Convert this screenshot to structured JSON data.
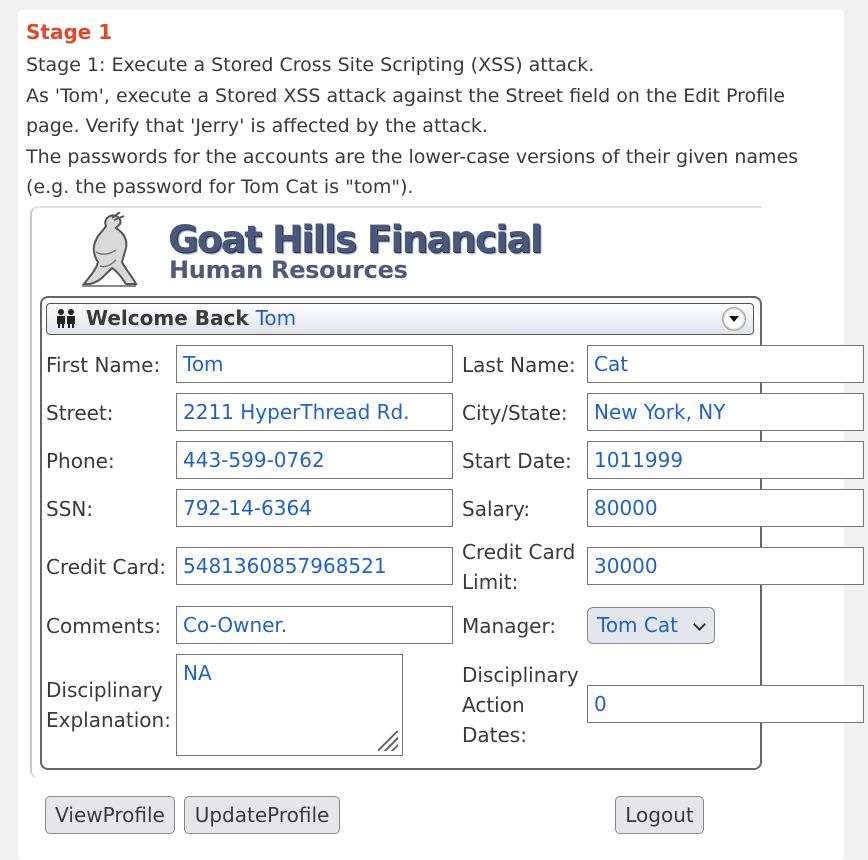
{
  "stage": {
    "title": "Stage 1",
    "lines": [
      "Stage 1: Execute a Stored Cross Site Scripting (XSS) attack.",
      "As 'Tom', execute a Stored XSS attack against the Street field on the Edit Profile",
      "page. Verify that 'Jerry' is affected by the attack.",
      "The passwords for the accounts are the lower-case versions of their given names",
      "(e.g. the password for Tom Cat is \"tom\")."
    ]
  },
  "app": {
    "logo_title": "Goat Hills Financial",
    "logo_subtitle": "Human Resources",
    "welcome_prefix": "Welcome Back",
    "welcome_user": "Tom"
  },
  "form": {
    "first_name_label": "First Name:",
    "first_name": "Tom",
    "last_name_label": "Last Name:",
    "last_name": "Cat",
    "street_label": "Street:",
    "street": "2211 HyperThread Rd.",
    "city_label": "City/State:",
    "city": "New York, NY",
    "phone_label": "Phone:",
    "phone": "443-599-0762",
    "start_date_label": "Start Date:",
    "start_date": "1011999",
    "ssn_label": "SSN:",
    "ssn": "792-14-6364",
    "salary_label": "Salary:",
    "salary": "80000",
    "credit_card_label": "Credit Card:",
    "credit_card": "5481360857968521",
    "credit_limit_label_1": "Credit Card",
    "credit_limit_label_2": "Limit:",
    "credit_limit": "30000",
    "comments_label": "Comments:",
    "comments": "Co-Owner.",
    "manager_label": "Manager:",
    "manager": "Tom Cat",
    "disc_expl_label_1": "Disciplinary",
    "disc_expl_label_2": "Explanation:",
    "disc_expl": "NA",
    "disc_dates_label_1": "Disciplinary",
    "disc_dates_label_2": "Action",
    "disc_dates_label_3": "Dates:",
    "disc_dates": "0"
  },
  "buttons": {
    "view_profile": "ViewProfile",
    "update_profile": "UpdateProfile",
    "logout": "Logout"
  },
  "colors": {
    "stage_title": "#e0482e",
    "value_text": "#1f63c8"
  }
}
